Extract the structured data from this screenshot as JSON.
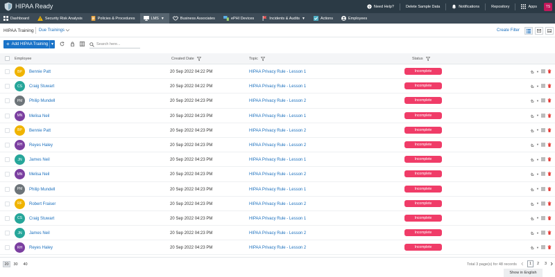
{
  "app": {
    "title": "HIPAA Ready",
    "user_initials": "TS"
  },
  "top_actions": [
    {
      "label": "Need Help?",
      "icon": "help-icon"
    },
    {
      "label": "Delete Sample Data",
      "icon": ""
    },
    {
      "label": "Notifications",
      "icon": "bell-icon"
    },
    {
      "label": "Repository",
      "icon": ""
    },
    {
      "label": "Apps",
      "icon": "grid-icon"
    }
  ],
  "nav": [
    {
      "label": "Dashboard",
      "icon": "dashboard-icon"
    },
    {
      "label": "Security Risk Analysis",
      "icon": "warning-icon"
    },
    {
      "label": "Policies & Procedures",
      "icon": "document-icon"
    },
    {
      "label": "LMS",
      "icon": "monitor-icon"
    },
    {
      "label": "Business Associates",
      "icon": "handshake-icon"
    },
    {
      "label": "ePHI Devices",
      "icon": "devices-icon"
    },
    {
      "label": "Incidents & Audits",
      "icon": "flag-icon"
    },
    {
      "label": "Actions",
      "icon": "checklist-icon"
    },
    {
      "label": "Employees",
      "icon": "employees-icon"
    }
  ],
  "subheader": {
    "title": "HIPAA Training",
    "dropdown": "Due Trainings",
    "create_filter": "Create Filter"
  },
  "toolbar": {
    "add_label": "Add HIPAA Training",
    "search_placeholder": "Search here..."
  },
  "columns": {
    "employee": "Employee",
    "created": "Created Date",
    "topic": "Topic",
    "status": "Status"
  },
  "rows": [
    {
      "initials": "BP",
      "name": "Bennie Patt",
      "date": "20 Sep 2022 04:22 PM",
      "topic": "HIPAA Privacy Rule - Lesson 1",
      "status": "Incomplete",
      "color": "#f0b400"
    },
    {
      "initials": "CS",
      "name": "Craig Stuwart",
      "date": "20 Sep 2022 04:22 PM",
      "topic": "HIPAA Privacy Rule - Lesson 1",
      "status": "Incomplete",
      "color": "#26a69a"
    },
    {
      "initials": "PM",
      "name": "Philip Mundell",
      "date": "20 Sep 2022 04:23 PM",
      "topic": "HIPAA Privacy Rule - Lesson 2",
      "status": "Incomplete",
      "color": "#6d7479"
    },
    {
      "initials": "MN",
      "name": "Melisa Neil",
      "date": "20 Sep 2022 04:23 PM",
      "topic": "HIPAA Privacy Rule - Lesson 1",
      "status": "Incomplete",
      "color": "#7b3fa0"
    },
    {
      "initials": "BP",
      "name": "Bennie Patt",
      "date": "20 Sep 2022 04:23 PM",
      "topic": "HIPAA Privacy Rule - Lesson 2",
      "status": "Incomplete",
      "color": "#f0b400"
    },
    {
      "initials": "RH",
      "name": "Reyes Haley",
      "date": "20 Sep 2022 04:23 PM",
      "topic": "HIPAA Privacy Rule - Lesson 2",
      "status": "Incomplete",
      "color": "#7b3fa0"
    },
    {
      "initials": "JN",
      "name": "James Neil",
      "date": "20 Sep 2022 04:23 PM",
      "topic": "HIPAA Privacy Rule - Lesson 1",
      "status": "Incomplete",
      "color": "#26a69a"
    },
    {
      "initials": "MN",
      "name": "Melisa Neil",
      "date": "20 Sep 2022 04:23 PM",
      "topic": "HIPAA Privacy Rule - Lesson 2",
      "status": "Incomplete",
      "color": "#7b3fa0"
    },
    {
      "initials": "PM",
      "name": "Philip Mundell",
      "date": "20 Sep 2022 04:23 PM",
      "topic": "HIPAA Privacy Rule - Lesson 1",
      "status": "Incomplete",
      "color": "#6d7479"
    },
    {
      "initials": "RF",
      "name": "Robert Fraiser",
      "date": "20 Sep 2022 04:23 PM",
      "topic": "HIPAA Privacy Rule - Lesson 2",
      "status": "Incomplete",
      "color": "#f0b400"
    },
    {
      "initials": "CS",
      "name": "Craig Stuwart",
      "date": "20 Sep 2022 04:23 PM",
      "topic": "HIPAA Privacy Rule - Lesson 1",
      "status": "Incomplete",
      "color": "#26a69a"
    },
    {
      "initials": "JN",
      "name": "James Neil",
      "date": "20 Sep 2022 04:23 PM",
      "topic": "HIPAA Privacy Rule - Lesson 2",
      "status": "Incomplete",
      "color": "#26a69a"
    },
    {
      "initials": "RH",
      "name": "Reyes Haley",
      "date": "20 Sep 2022 04:23 PM",
      "topic": "HIPAA Privacy Rule - Lesson 2",
      "status": "Incomplete",
      "color": "#7b3fa0"
    }
  ],
  "footer": {
    "page_sizes": [
      "20",
      "30",
      "40"
    ],
    "total": "Total 3 page(s) for 48 records",
    "pages": [
      "1",
      "2",
      "3"
    ],
    "language": "Show in English"
  },
  "colors": {
    "topbar": "#2b3a45",
    "nav": "#3d4b57",
    "primary": "#1a73c8",
    "link": "#1a6fbd",
    "status": "#f03c68"
  }
}
